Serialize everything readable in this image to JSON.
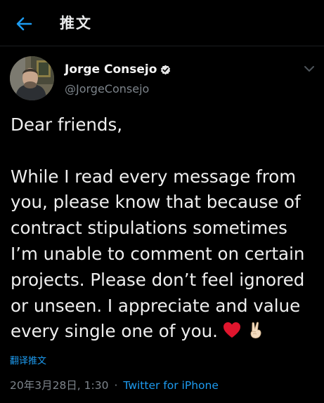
{
  "header": {
    "title": "推文",
    "back_icon": "arrow-left-icon"
  },
  "author": {
    "display_name": "Jorge Consejo",
    "handle": "@JorgeConsejo",
    "verified": true
  },
  "tweet": {
    "text": "Dear friends,\n\nWhile I read every message from you, please know that because of contract stipulations sometimes I’m unable to comment on certain projects. Please don’t feel ignored or unseen. I appreciate and value every single one of you.",
    "emojis": [
      "red-heart-icon",
      "victory-hand-icon"
    ],
    "translate_label": "翻译推文",
    "timestamp": "20年3月28日, 1:30",
    "separator": "·",
    "source": "Twitter for iPhone"
  },
  "colors": {
    "background": "#000000",
    "accent": "#1d9bf0",
    "muted": "#7d848b",
    "text": "#efefef"
  }
}
